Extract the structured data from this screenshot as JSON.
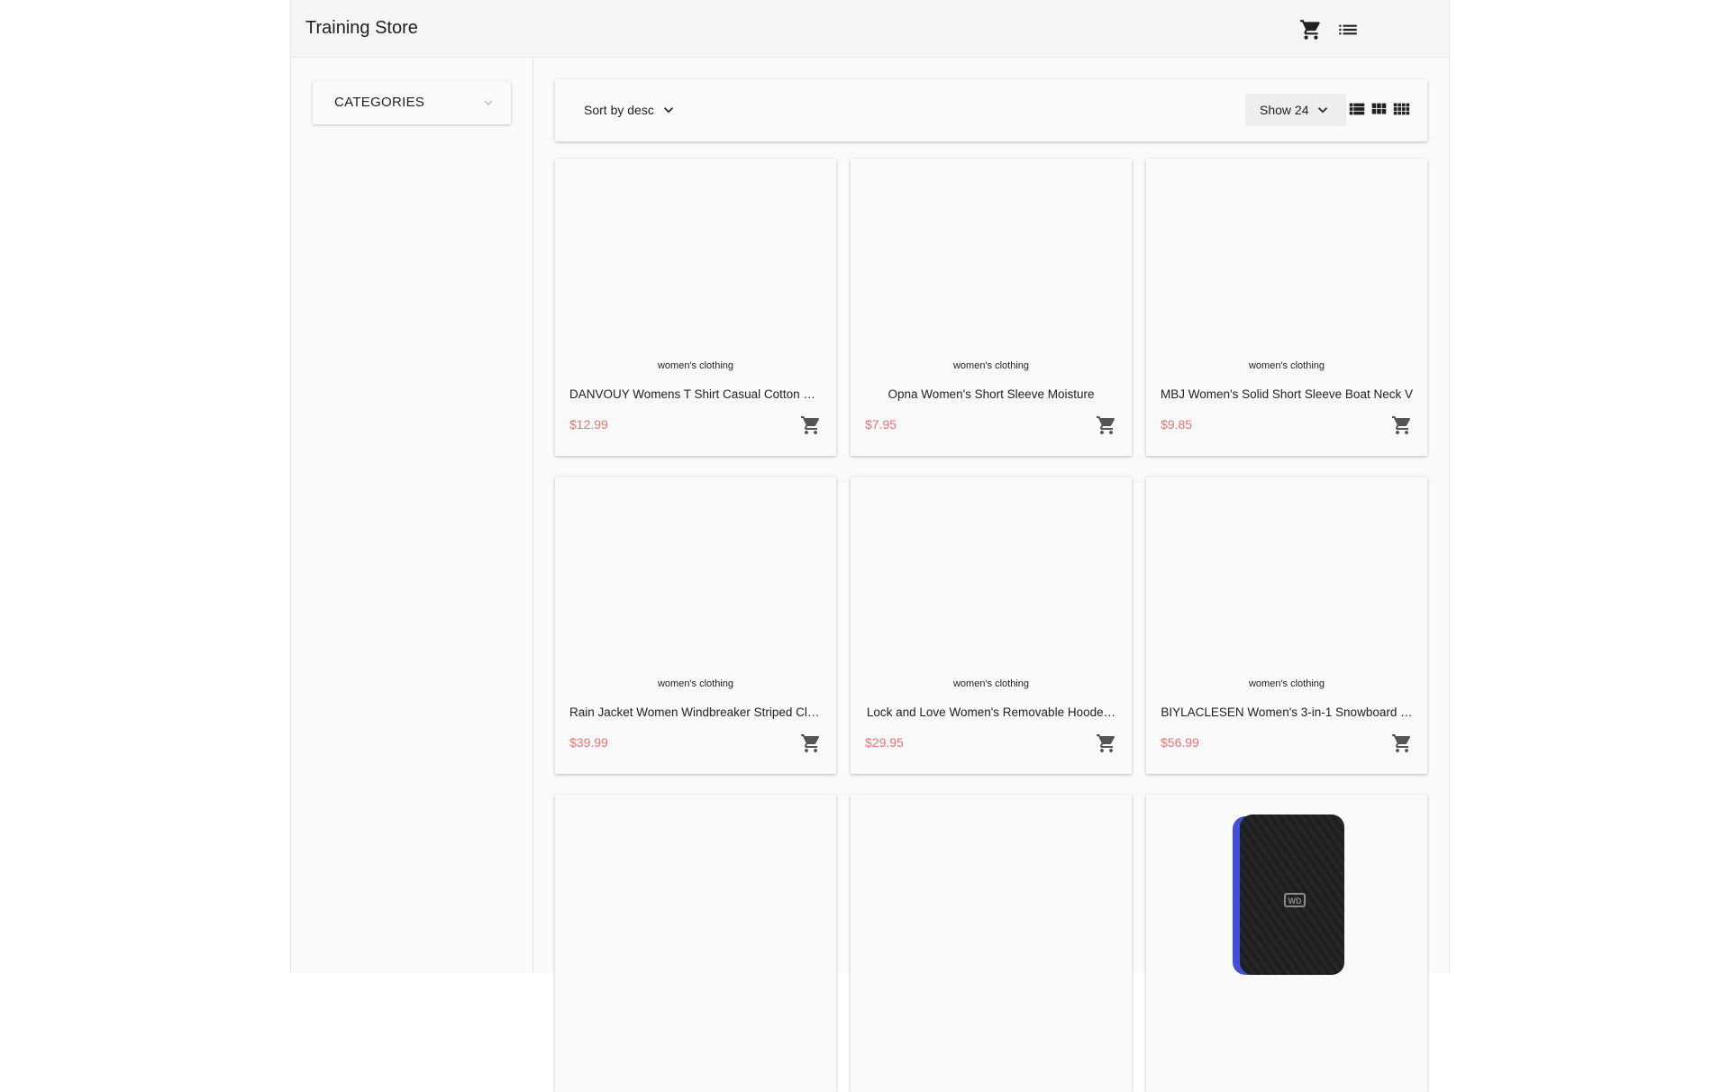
{
  "header": {
    "title": "Training Store",
    "cart_icon": "cart-icon",
    "list_icon": "list-icon"
  },
  "sidebar": {
    "categories_label": "CATEGORIES",
    "expand_icon": "chevron-down-icon"
  },
  "toolbar": {
    "sort_label": "Sort by desc",
    "show_label": "Show 24",
    "view_icons": [
      "view-list-icon",
      "view-module-icon",
      "view-comfy-icon"
    ]
  },
  "colors": {
    "price": "#e57373",
    "topbar": "#f5f5f5",
    "background": "#fafafa"
  },
  "products": [
    {
      "category": "women's clothing",
      "title": "DANVOUY Womens T Shirt Casual Cotton S…",
      "price": "$12.99"
    },
    {
      "category": "women's clothing",
      "title": "Opna Women's Short Sleeve Moisture",
      "price": "$7.95"
    },
    {
      "category": "women's clothing",
      "title": "MBJ Women's Solid Short Sleeve Boat Neck V",
      "price": "$9.85"
    },
    {
      "category": "women's clothing",
      "title": "Rain Jacket Women Windbreaker Striped Cli…",
      "price": "$39.99"
    },
    {
      "category": "women's clothing",
      "title": "Lock and Love Women's Removable Hoode…",
      "price": "$29.95"
    },
    {
      "category": "women's clothing",
      "title": "BIYLACLESEN Women's 3-in-1 Snowboard …",
      "price": "$56.99"
    }
  ],
  "partial_products_image": "external-hard-drive"
}
